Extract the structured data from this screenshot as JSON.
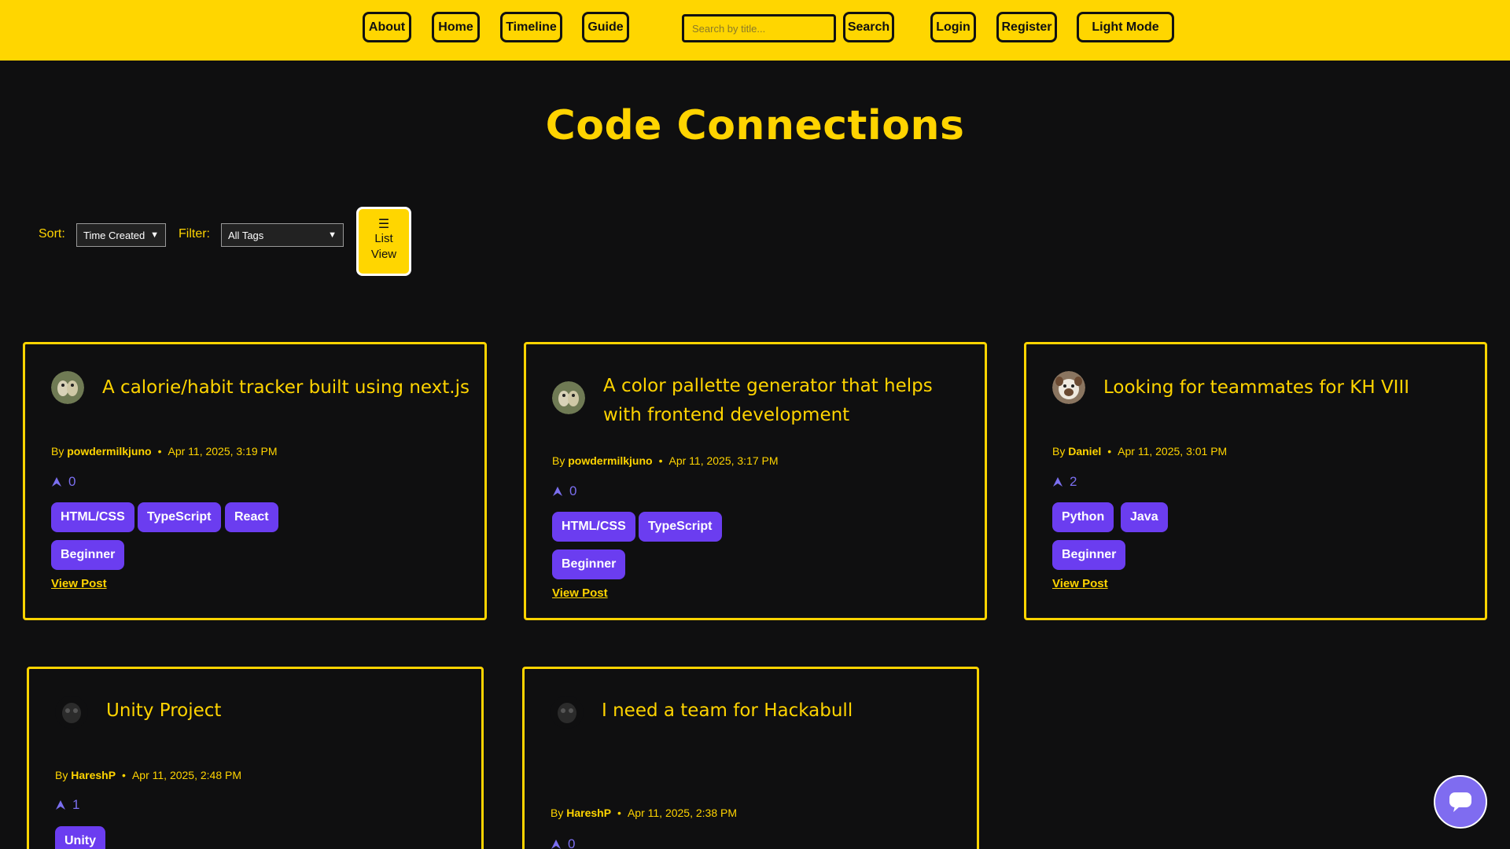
{
  "nav": {
    "about": "About",
    "home": "Home",
    "timeline": "Timeline",
    "guide": "Guide",
    "search_placeholder": "Search by title...",
    "search": "Search",
    "login": "Login",
    "register": "Register",
    "mode": "Light Mode"
  },
  "title": "Code Connections",
  "controls": {
    "sort_label": "Sort:",
    "sort_value": "Time Created",
    "filter_label": "Filter:",
    "filter_value": "All Tags",
    "menu_icon": "☰",
    "list_view_1": "List",
    "list_view_2": "View"
  },
  "posts": [
    {
      "title": "A calorie/habit tracker built using next.js",
      "by": "By",
      "author": "powdermilkjuno",
      "date": "Apr 11, 2025, 3:19 PM",
      "votes": "0",
      "tags": [
        "HTML/CSS",
        "TypeScript",
        "React",
        "Beginner"
      ],
      "link": "View Post"
    },
    {
      "title_line1": "A color pallette generator that helps",
      "title_line2": "with frontend development",
      "by": "By",
      "author": "powdermilkjuno",
      "date": "Apr 11, 2025, 3:17 PM",
      "votes": "0",
      "tags": [
        "HTML/CSS",
        "TypeScript",
        "Beginner"
      ],
      "link": "View Post"
    },
    {
      "title": "Looking for teammates for KH VIII",
      "by": "By",
      "author": "Daniel",
      "date": "Apr 11, 2025, 3:01 PM",
      "votes": "2",
      "tags": [
        "Python",
        "Java",
        "Beginner"
      ],
      "link": "View Post"
    },
    {
      "title": "Unity Project",
      "by": "By",
      "author": "HareshP",
      "date": "Apr 11, 2025, 2:48 PM",
      "votes": "1",
      "tags": [
        "Unity"
      ]
    },
    {
      "title": "I need a team for Hackabull",
      "by": "By",
      "author": "HareshP",
      "date": "Apr 11, 2025, 2:38 PM",
      "votes": "0"
    }
  ],
  "colors": {
    "accent": "#ffd600",
    "background": "#0f0f10",
    "tag": "#6b3df0",
    "upvote": "#7b6ff0"
  },
  "icons": {
    "upvote": "upvote-arrow-icon",
    "chat": "chat-bubble-icon",
    "menu": "hamburger-menu-icon"
  }
}
